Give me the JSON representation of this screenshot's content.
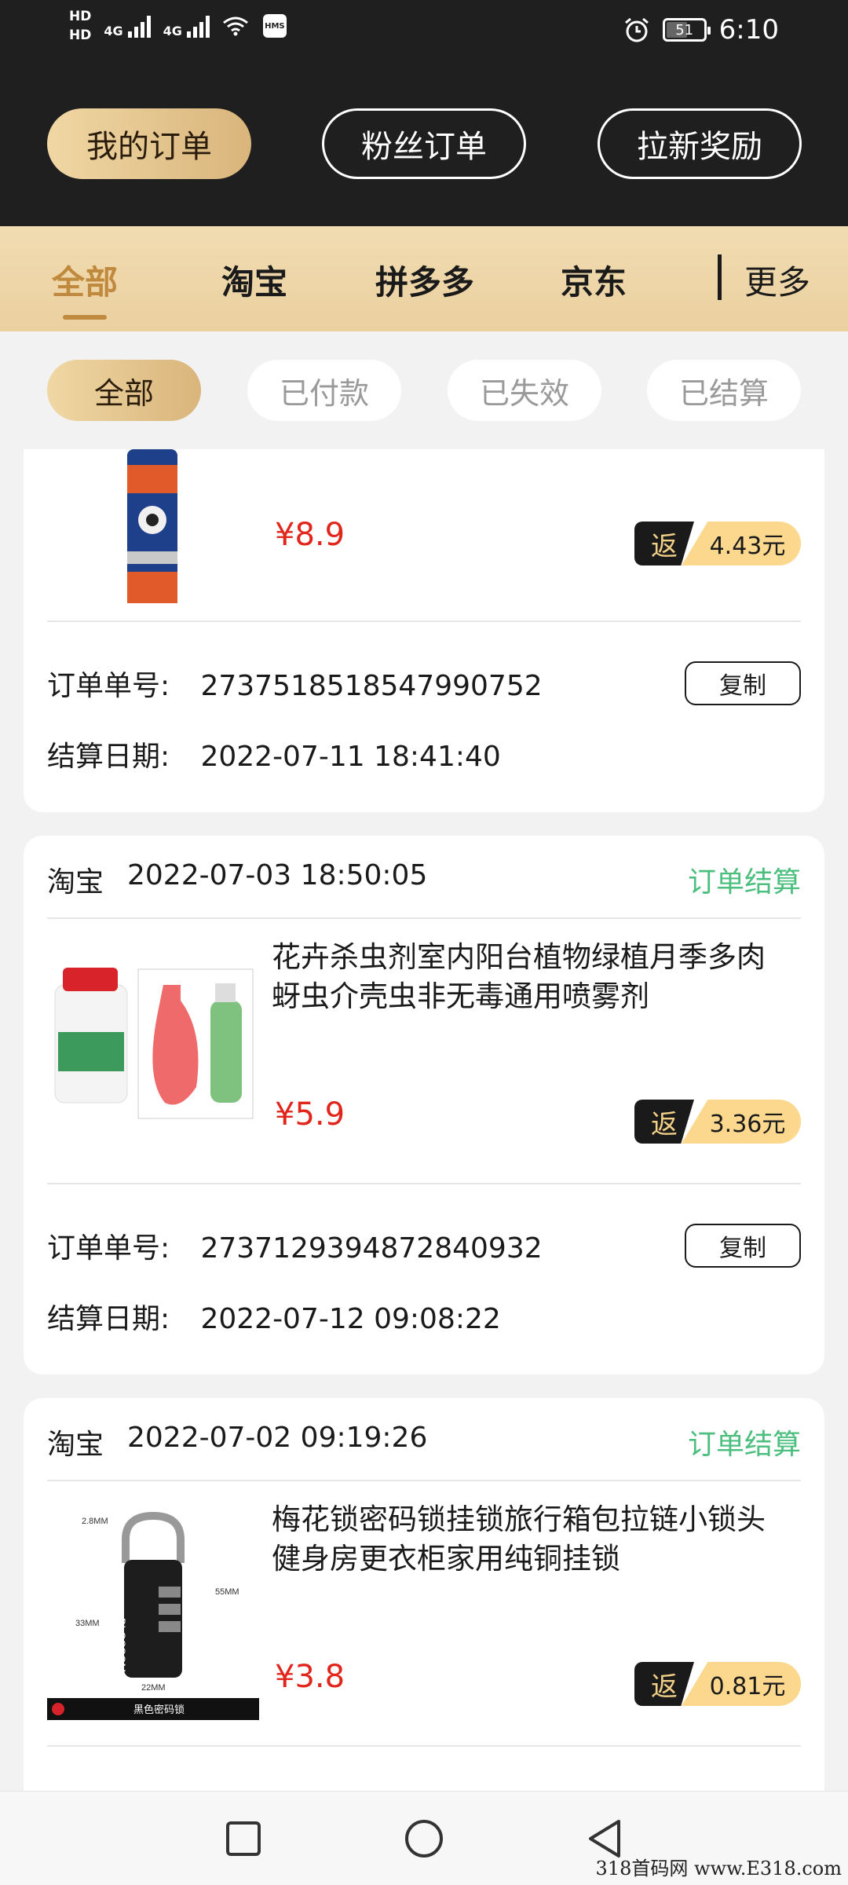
{
  "status_bar": {
    "hd1": "HD",
    "hd2": "HD",
    "net1": "4G",
    "net2": "4G",
    "hms": "HMS",
    "battery": "51",
    "time": "6:10"
  },
  "header_tabs": [
    "我的订单",
    "粉丝订单",
    "拉新奖励"
  ],
  "platform_tabs": [
    "全部",
    "淘宝",
    "拼多多",
    "京东"
  ],
  "more_label": "更多",
  "status_filters": [
    "全部",
    "已付款",
    "已失效",
    "已结算"
  ],
  "labels": {
    "order_no": "订单单号:",
    "settle_date": "结算日期:",
    "copy": "复制",
    "rebate": "返"
  },
  "orders": [
    {
      "price": "¥8.9",
      "rebate": "4.43元",
      "order_no": "2737518518547990752",
      "settle_date": "2022-07-11 18:41:40"
    },
    {
      "platform": "淘宝",
      "date": "2022-07-03 18:50:05",
      "status": "订单结算",
      "title": "花卉杀虫剂室内阳台植物绿植月季多肉蚜虫介壳虫非无毒通用喷雾剂",
      "price": "¥5.9",
      "rebate": "3.36元",
      "order_no": "2737129394872840932",
      "settle_date": "2022-07-12 09:08:22"
    },
    {
      "platform": "淘宝",
      "date": "2022-07-02 09:19:26",
      "status": "订单结算",
      "title": "梅花锁密码锁挂锁旅行箱包拉链小锁头健身房更衣柜家用纯铜挂锁",
      "price": "¥3.8",
      "rebate": "0.81元",
      "lock_labels": {
        "w": "2.8MM",
        "h1": "33MM",
        "h2": "55MM",
        "base": "22MM",
        "brand": "BLOSSOM",
        "footer": "黑色密码锁"
      }
    }
  ],
  "watermark": "318首码网 www.E318.com"
}
